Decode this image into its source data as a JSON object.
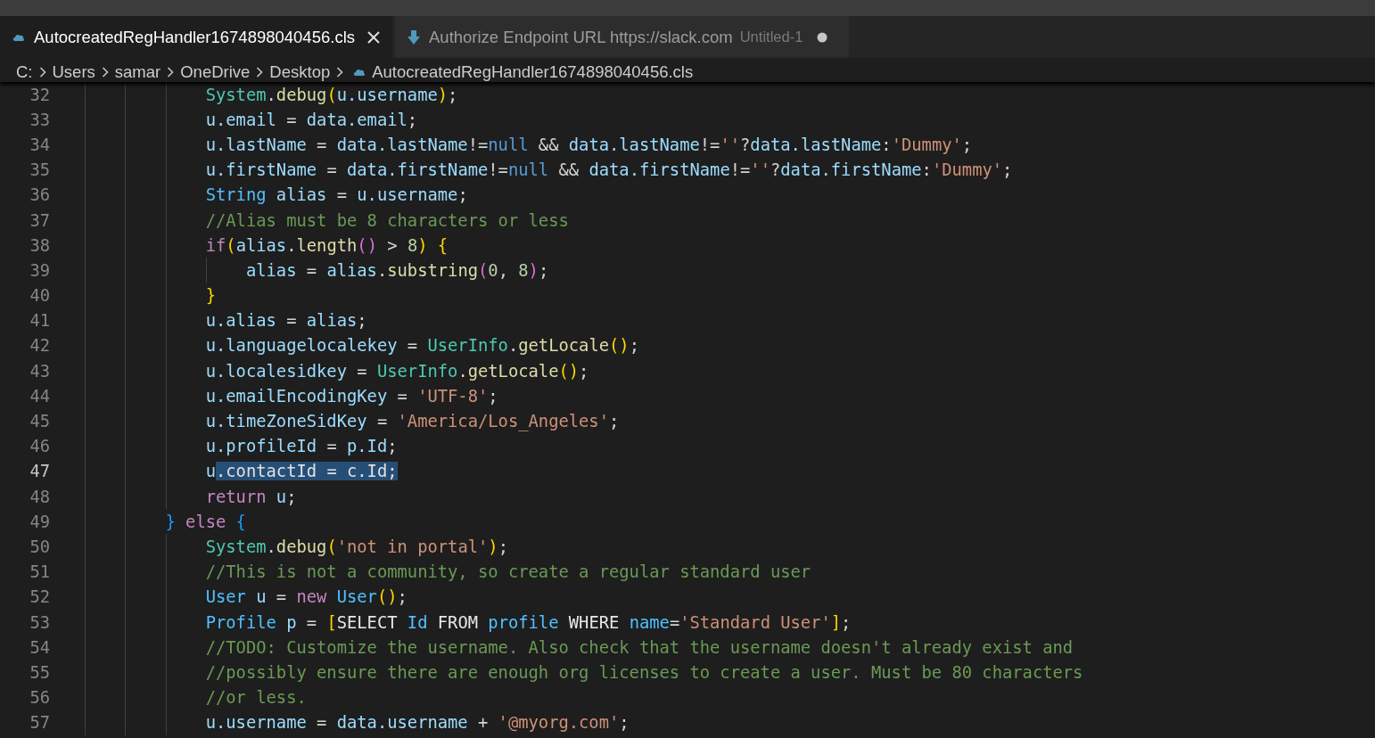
{
  "tabs": [
    {
      "label": "AutocreatedRegHandler1674898040456.cls",
      "kind": "apex",
      "selected": true,
      "modified": false
    },
    {
      "label": "Authorize Endpoint URL https://slack.com",
      "description": "Untitled-1",
      "kind": "download",
      "selected": false,
      "modified": true
    }
  ],
  "breadcrumb": [
    {
      "label": "C:",
      "kind": "folder"
    },
    {
      "label": "Users",
      "kind": "folder"
    },
    {
      "label": "samar",
      "kind": "folder"
    },
    {
      "label": "OneDrive",
      "kind": "folder"
    },
    {
      "label": "Desktop",
      "kind": "folder"
    },
    {
      "label": "AutocreatedRegHandler1674898040456.cls",
      "kind": "file"
    }
  ],
  "lines": [
    {
      "number": "32",
      "current": false,
      "tokens": [
        {
          "kind": "s",
          "text": "            System"
        },
        {
          "kind": "p",
          "text": "."
        },
        {
          "kind": "f",
          "text": "debug"
        },
        {
          "kind": "b1",
          "text": "("
        },
        {
          "kind": "v",
          "text": "u.username"
        },
        {
          "kind": "b1",
          "text": ")"
        },
        {
          "kind": "p",
          "text": ";"
        }
      ]
    },
    {
      "number": "33",
      "current": false,
      "tokens": [
        {
          "kind": "v",
          "text": "            u.email"
        },
        {
          "kind": "p",
          "text": " = "
        },
        {
          "kind": "v",
          "text": "data.email"
        },
        {
          "kind": "p",
          "text": ";"
        }
      ]
    },
    {
      "number": "34",
      "current": false,
      "tokens": [
        {
          "kind": "v",
          "text": "            u.lastName"
        },
        {
          "kind": "p",
          "text": " = "
        },
        {
          "kind": "v",
          "text": "data.lastName"
        },
        {
          "kind": "p",
          "text": "!="
        },
        {
          "kind": "l",
          "text": "null"
        },
        {
          "kind": "p",
          "text": " && "
        },
        {
          "kind": "v",
          "text": "data.lastName"
        },
        {
          "kind": "p",
          "text": "!="
        },
        {
          "kind": "str",
          "text": "''"
        },
        {
          "kind": "p",
          "text": "?"
        },
        {
          "kind": "v",
          "text": "data.lastName"
        },
        {
          "kind": "p",
          "text": ":"
        },
        {
          "kind": "str",
          "text": "'Dummy'"
        },
        {
          "kind": "p",
          "text": ";"
        }
      ]
    },
    {
      "number": "35",
      "current": false,
      "tokens": [
        {
          "kind": "v",
          "text": "            u.firstName"
        },
        {
          "kind": "p",
          "text": " = "
        },
        {
          "kind": "v",
          "text": "data.firstName"
        },
        {
          "kind": "p",
          "text": "!="
        },
        {
          "kind": "l",
          "text": "null"
        },
        {
          "kind": "p",
          "text": " && "
        },
        {
          "kind": "v",
          "text": "data.firstName"
        },
        {
          "kind": "p",
          "text": "!="
        },
        {
          "kind": "str",
          "text": "''"
        },
        {
          "kind": "p",
          "text": "?"
        },
        {
          "kind": "v",
          "text": "data.firstName"
        },
        {
          "kind": "p",
          "text": ":"
        },
        {
          "kind": "str",
          "text": "'Dummy'"
        },
        {
          "kind": "p",
          "text": ";"
        }
      ]
    },
    {
      "number": "36",
      "current": false,
      "tokens": [
        {
          "kind": "t",
          "text": "            String"
        },
        {
          "kind": "v",
          "text": " alias"
        },
        {
          "kind": "p",
          "text": " = "
        },
        {
          "kind": "v",
          "text": "u.username"
        },
        {
          "kind": "p",
          "text": ";"
        }
      ]
    },
    {
      "number": "37",
      "current": false,
      "tokens": [
        {
          "kind": "c",
          "text": "            //Alias must be 8 characters or less"
        }
      ]
    },
    {
      "number": "38",
      "current": false,
      "tokens": [
        {
          "kind": "k",
          "text": "            if"
        },
        {
          "kind": "b1",
          "text": "("
        },
        {
          "kind": "v",
          "text": "alias"
        },
        {
          "kind": "p",
          "text": "."
        },
        {
          "kind": "f",
          "text": "length"
        },
        {
          "kind": "b2",
          "text": "()"
        },
        {
          "kind": "p",
          "text": " > "
        },
        {
          "kind": "n",
          "text": "8"
        },
        {
          "kind": "b1",
          "text": ") {"
        }
      ]
    },
    {
      "number": "39",
      "current": false,
      "tokens": [
        {
          "kind": "v",
          "text": "                alias"
        },
        {
          "kind": "p",
          "text": " = "
        },
        {
          "kind": "v",
          "text": "alias"
        },
        {
          "kind": "p",
          "text": "."
        },
        {
          "kind": "f",
          "text": "substring"
        },
        {
          "kind": "b2",
          "text": "("
        },
        {
          "kind": "n",
          "text": "0"
        },
        {
          "kind": "p",
          "text": ", "
        },
        {
          "kind": "n",
          "text": "8"
        },
        {
          "kind": "b2",
          "text": ")"
        },
        {
          "kind": "p",
          "text": ";"
        }
      ]
    },
    {
      "number": "40",
      "current": false,
      "tokens": [
        {
          "kind": "b1",
          "text": "            }"
        }
      ]
    },
    {
      "number": "41",
      "current": false,
      "tokens": [
        {
          "kind": "v",
          "text": "            u.alias"
        },
        {
          "kind": "p",
          "text": " = "
        },
        {
          "kind": "v",
          "text": "alias"
        },
        {
          "kind": "p",
          "text": ";"
        }
      ]
    },
    {
      "number": "42",
      "current": false,
      "tokens": [
        {
          "kind": "v",
          "text": "            u.languagelocalekey"
        },
        {
          "kind": "p",
          "text": " = "
        },
        {
          "kind": "s",
          "text": "UserInfo"
        },
        {
          "kind": "p",
          "text": "."
        },
        {
          "kind": "f",
          "text": "getLocale"
        },
        {
          "kind": "b1",
          "text": "()"
        },
        {
          "kind": "p",
          "text": ";"
        }
      ]
    },
    {
      "number": "43",
      "current": false,
      "tokens": [
        {
          "kind": "v",
          "text": "            u.localesidkey"
        },
        {
          "kind": "p",
          "text": " = "
        },
        {
          "kind": "s",
          "text": "UserInfo"
        },
        {
          "kind": "p",
          "text": "."
        },
        {
          "kind": "f",
          "text": "getLocale"
        },
        {
          "kind": "b1",
          "text": "()"
        },
        {
          "kind": "p",
          "text": ";"
        }
      ]
    },
    {
      "number": "44",
      "current": false,
      "tokens": [
        {
          "kind": "v",
          "text": "            u.emailEncodingKey"
        },
        {
          "kind": "p",
          "text": " = "
        },
        {
          "kind": "str",
          "text": "'UTF-8'"
        },
        {
          "kind": "p",
          "text": ";"
        }
      ]
    },
    {
      "number": "45",
      "current": false,
      "tokens": [
        {
          "kind": "v",
          "text": "            u.timeZoneSidKey"
        },
        {
          "kind": "p",
          "text": " = "
        },
        {
          "kind": "str",
          "text": "'America/Los_Angeles'"
        },
        {
          "kind": "p",
          "text": ";"
        }
      ]
    },
    {
      "number": "46",
      "current": false,
      "tokens": [
        {
          "kind": "v",
          "text": "            u.profileId"
        },
        {
          "kind": "p",
          "text": " = "
        },
        {
          "kind": "v",
          "text": "p.Id"
        },
        {
          "kind": "p",
          "text": ";"
        }
      ]
    },
    {
      "number": "47",
      "current": true,
      "tokens": [
        {
          "kind": "v",
          "text": "            u"
        },
        {
          "kind": "sel",
          "text": ".contactId = c.Id;"
        }
      ]
    },
    {
      "number": "48",
      "current": false,
      "tokens": [
        {
          "kind": "k",
          "text": "            return"
        },
        {
          "kind": "v",
          "text": " u"
        },
        {
          "kind": "p",
          "text": ";"
        }
      ]
    },
    {
      "number": "49",
      "current": false,
      "tokens": [
        {
          "kind": "b3",
          "text": "        }"
        },
        {
          "kind": "k",
          "text": " else "
        },
        {
          "kind": "b3",
          "text": "{"
        }
      ]
    },
    {
      "number": "50",
      "current": false,
      "tokens": [
        {
          "kind": "s",
          "text": "            System"
        },
        {
          "kind": "p",
          "text": "."
        },
        {
          "kind": "f",
          "text": "debug"
        },
        {
          "kind": "b1",
          "text": "("
        },
        {
          "kind": "str",
          "text": "'not in portal'"
        },
        {
          "kind": "b1",
          "text": ")"
        },
        {
          "kind": "p",
          "text": ";"
        }
      ]
    },
    {
      "number": "51",
      "current": false,
      "tokens": [
        {
          "kind": "c",
          "text": "            //This is not a community, so create a regular standard user"
        }
      ]
    },
    {
      "number": "52",
      "current": false,
      "tokens": [
        {
          "kind": "t",
          "text": "            User"
        },
        {
          "kind": "v",
          "text": " u"
        },
        {
          "kind": "p",
          "text": " = "
        },
        {
          "kind": "k",
          "text": "new "
        },
        {
          "kind": "t",
          "text": "User"
        },
        {
          "kind": "b1",
          "text": "()"
        },
        {
          "kind": "p",
          "text": ";"
        }
      ]
    },
    {
      "number": "53",
      "current": false,
      "tokens": [
        {
          "kind": "t",
          "text": "            Profile"
        },
        {
          "kind": "v",
          "text": " p"
        },
        {
          "kind": "p",
          "text": " = "
        },
        {
          "kind": "b1",
          "text": "["
        },
        {
          "kind": "sq",
          "text": "SELECT "
        },
        {
          "kind": "t",
          "text": "Id"
        },
        {
          "kind": "sq",
          "text": " FROM "
        },
        {
          "kind": "t",
          "text": "profile"
        },
        {
          "kind": "sq",
          "text": " WHERE "
        },
        {
          "kind": "t",
          "text": "name"
        },
        {
          "kind": "p",
          "text": "="
        },
        {
          "kind": "str",
          "text": "'Standard User'"
        },
        {
          "kind": "b1",
          "text": "]"
        },
        {
          "kind": "p",
          "text": ";"
        }
      ]
    },
    {
      "number": "54",
      "current": false,
      "tokens": [
        {
          "kind": "c",
          "text": "            //TODO: Customize the username. Also check that the username doesn't already exist and"
        }
      ]
    },
    {
      "number": "55",
      "current": false,
      "tokens": [
        {
          "kind": "c",
          "text": "            //possibly ensure there are enough org licenses to create a user. Must be 80 characters"
        }
      ]
    },
    {
      "number": "56",
      "current": false,
      "tokens": [
        {
          "kind": "c",
          "text": "            //or less."
        }
      ]
    },
    {
      "number": "57",
      "current": false,
      "tokens": [
        {
          "kind": "v",
          "text": "            u.username"
        },
        {
          "kind": "p",
          "text": " = "
        },
        {
          "kind": "v",
          "text": "data.username"
        },
        {
          "kind": "p",
          "text": " + "
        },
        {
          "kind": "str",
          "text": "'@myorg.com'"
        },
        {
          "kind": "p",
          "text": ";"
        }
      ]
    }
  ]
}
